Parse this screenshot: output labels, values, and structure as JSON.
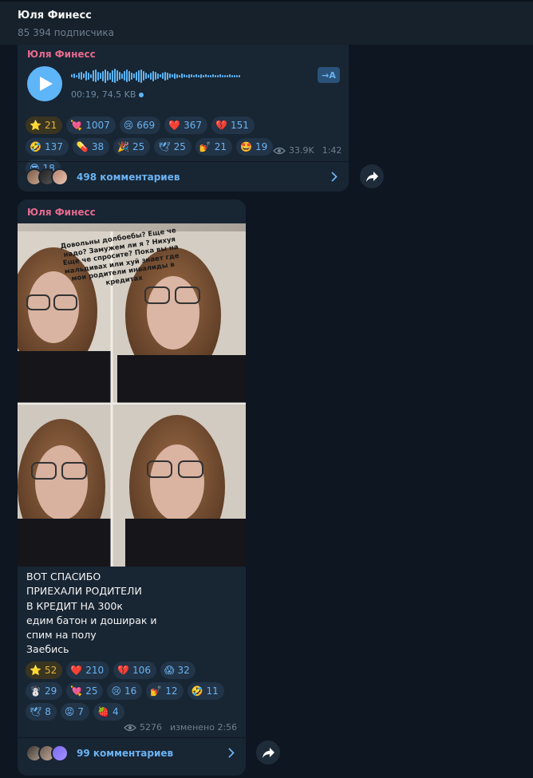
{
  "header": {
    "title": "Юля Финесс",
    "subtitle": "85 394 подписчика"
  },
  "posts": [
    {
      "author": "Юля Финесс",
      "audio": {
        "meta": "00:19, 74.5 KB",
        "transcribe_label": "→A"
      },
      "reactions": [
        {
          "emoji": "⭐",
          "count": "21",
          "gold": true
        },
        {
          "emoji": "💘",
          "count": "1007"
        },
        {
          "emoji": "😢",
          "count": "669"
        },
        {
          "emoji": "❤️",
          "count": "367"
        },
        {
          "emoji": "💔",
          "count": "151"
        },
        {
          "emoji": "🤣",
          "count": "137"
        },
        {
          "emoji": "💊",
          "count": "38"
        },
        {
          "emoji": "🎉",
          "count": "25"
        },
        {
          "emoji": "🕊",
          "count": "25"
        },
        {
          "emoji": "💅",
          "count": "21"
        },
        {
          "emoji": "🤩",
          "count": "19"
        },
        {
          "emoji": "😎",
          "count": "18"
        }
      ],
      "views": "33.9K",
      "time": "1:42",
      "comments": "498 комментариев"
    },
    {
      "author": "Юля Финесс",
      "photo_caption": "Довольны долбоебы? Еще че надо? Замужем ли я ? Нихуя Еще че спросите? Пока вы на мальдивах или хуй знает где мои родители инвалиды в кредитах",
      "text_lines": [
        "ВОТ СПАСИБО",
        "ПРИЕХАЛИ РОДИТЕЛИ",
        "В КРЕДИТ НА 300к",
        "едим батон и доширак и",
        "спим на полу",
        "Заебись"
      ],
      "reactions": [
        {
          "emoji": "⭐",
          "count": "52",
          "gold": true
        },
        {
          "emoji": "❤️",
          "count": "210"
        },
        {
          "emoji": "💔",
          "count": "106"
        },
        {
          "emoji": "😱",
          "count": "32"
        },
        {
          "emoji": "☃️",
          "count": "29"
        },
        {
          "emoji": "💘",
          "count": "25"
        },
        {
          "emoji": "😢",
          "count": "16"
        },
        {
          "emoji": "💅",
          "count": "12"
        },
        {
          "emoji": "🤣",
          "count": "11"
        },
        {
          "emoji": "🕊",
          "count": "8"
        },
        {
          "emoji": "😡",
          "count": "7"
        },
        {
          "emoji": "🍓",
          "count": "4"
        }
      ],
      "views": "5276",
      "edited_time": "изменено 2:56",
      "comments": "99 комментариев"
    }
  ],
  "colors": {
    "background": "#0e1621",
    "bubble": "#182533",
    "accent": "#6ab3f3",
    "author": "#e56a8e"
  }
}
